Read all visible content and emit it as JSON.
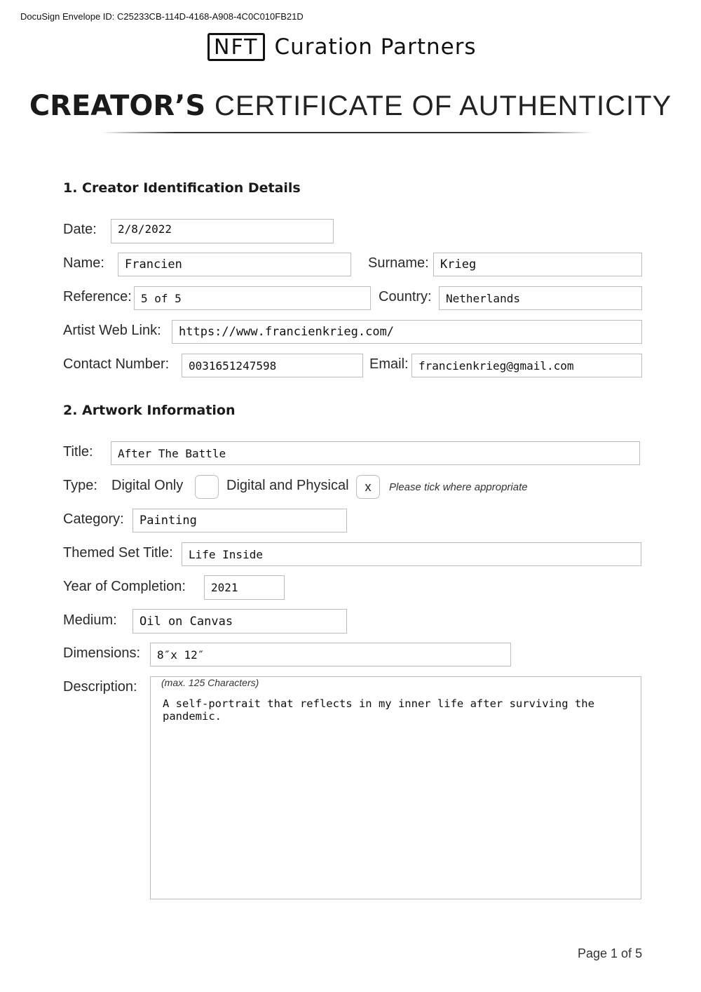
{
  "envelope_id": "DocuSign Envelope ID: C25233CB-114D-4168-A908-4C0C010FB21D",
  "logo": {
    "box_text": "NFT",
    "text": "Curation Partners"
  },
  "title": {
    "bold": "CREATOR’S",
    "light": "CERTIFICATE OF AUTHENTICITY"
  },
  "section1": {
    "heading": "1. Creator Identification Details",
    "date": {
      "label": "Date:",
      "value": "2/8/2022"
    },
    "name": {
      "label": "Name:",
      "value": "Francien"
    },
    "surname": {
      "label": "Surname:",
      "value": "Krieg"
    },
    "reference": {
      "label": "Reference:",
      "value": "5 of 5"
    },
    "country": {
      "label": "Country:",
      "value": "Netherlands"
    },
    "web_link": {
      "label": "Artist Web Link:",
      "value": "https://www.francienkrieg.com/"
    },
    "contact": {
      "label": "Contact Number:",
      "value": "0031651247598"
    },
    "email": {
      "label": "Email:",
      "value": "francienkrieg@gmail.com"
    }
  },
  "section2": {
    "heading": "2. Artwork Information",
    "title": {
      "label": "Title:",
      "value": "After The Battle"
    },
    "type": {
      "label": "Type:",
      "option1": {
        "label": "Digital Only",
        "value": ""
      },
      "option2": {
        "label": "Digital and Physical",
        "value": "x"
      },
      "hint": "Please tick where appropriate"
    },
    "category": {
      "label": "Category:",
      "value": "Painting"
    },
    "themed_set": {
      "label": "Themed Set Title:",
      "value": "Life Inside"
    },
    "year": {
      "label": "Year of Completion:",
      "value": "2021"
    },
    "medium": {
      "label": "Medium:",
      "value": "Oil on Canvas"
    },
    "dimensions": {
      "label": "Dimensions:",
      "value": "8″x 12″"
    },
    "description": {
      "label": "Description:",
      "hint": "(max. 125 Characters)",
      "value": "A self-portrait that reflects in my inner life after surviving the pandemic."
    }
  },
  "footer": {
    "page": "Page 1 of 5"
  }
}
